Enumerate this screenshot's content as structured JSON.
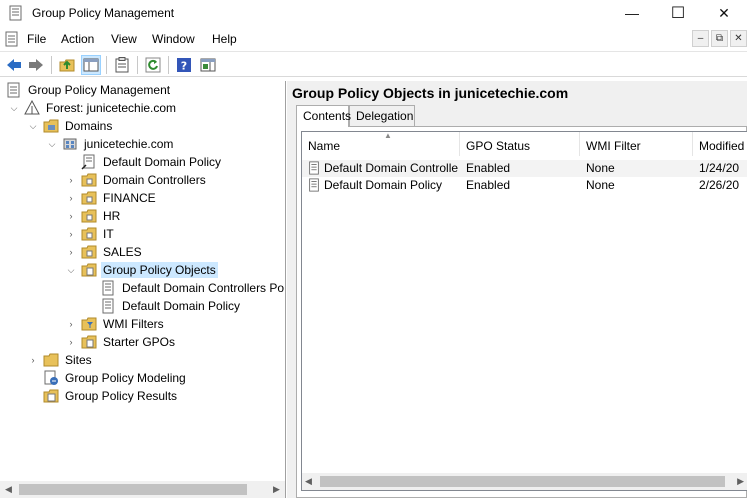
{
  "window": {
    "title": "Group Policy Management",
    "controls": [
      "—",
      "☐",
      "✕"
    ]
  },
  "menu": {
    "items": [
      "File",
      "Action",
      "View",
      "Window",
      "Help"
    ],
    "mdi_controls": [
      "–",
      "⧉",
      "✕"
    ]
  },
  "toolbar": {
    "buttons": [
      "back-icon",
      "forward-icon",
      "up-folder-icon",
      "show-hide-tree-icon",
      "properties-icon",
      "refresh-icon",
      "help-icon",
      "action-pane-icon"
    ]
  },
  "tree": {
    "root": "Group Policy Management",
    "forest": "Forest: junicetechie.com",
    "domains": "Domains",
    "domain": "junicetechie.com",
    "items": {
      "default_domain_policy": "Default Domain Policy",
      "domain_controllers": "Domain Controllers",
      "finance": "FINANCE",
      "hr": "HR",
      "it": "IT",
      "sales": "SALES",
      "gpo": "Group Policy Objects",
      "gpo_child_1": "Default Domain Controllers Po",
      "gpo_child_2": "Default Domain Policy",
      "wmi_filters": "WMI Filters",
      "starter_gpos": "Starter GPOs"
    },
    "sites": "Sites",
    "modeling": "Group Policy Modeling",
    "results": "Group Policy Results"
  },
  "content": {
    "title": "Group Policy Objects in junicetechie.com",
    "tabs": [
      "Contents",
      "Delegation"
    ],
    "columns": [
      "Name",
      "GPO Status",
      "WMI Filter",
      "Modified"
    ],
    "rows": [
      {
        "name": "Default Domain Controller...",
        "status": "Enabled",
        "wmi": "None",
        "modified": "1/24/20"
      },
      {
        "name": "Default Domain Policy",
        "status": "Enabled",
        "wmi": "None",
        "modified": "2/26/20"
      }
    ]
  },
  "colors": {
    "selection": "#cce8ff",
    "folder": "#e8c15a",
    "accent_blue": "#2a6cc4"
  }
}
